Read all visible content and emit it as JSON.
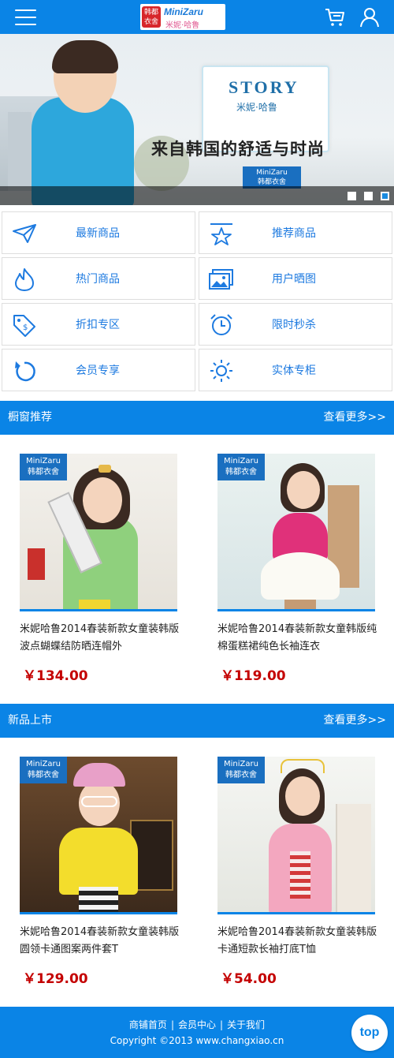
{
  "header": {
    "logo_badge": "韩都衣舍",
    "logo_brand": "MiniZaru",
    "logo_sub": "米妮·哈鲁"
  },
  "banner": {
    "story_title": "STORY",
    "story_sub": "米妮·哈鲁",
    "slogan": "来自韩国的舒适与时尚",
    "tag_en": "MiniZaru",
    "tag_cn": "韩都衣舍",
    "slide_count": 3,
    "active_slide": 3
  },
  "categories": [
    {
      "label": "最新商品",
      "icon": "paper-plane-icon"
    },
    {
      "label": "推荐商品",
      "icon": "star-icon"
    },
    {
      "label": "热门商品",
      "icon": "flame-icon"
    },
    {
      "label": "用户晒图",
      "icon": "image-icon"
    },
    {
      "label": "折扣专区",
      "icon": "price-tag-icon"
    },
    {
      "label": "限时秒杀",
      "icon": "alarm-clock-icon"
    },
    {
      "label": "会员专享",
      "icon": "refresh-icon"
    },
    {
      "label": "实体专柜",
      "icon": "sun-icon"
    }
  ],
  "sections": [
    {
      "title": "橱窗推荐",
      "more": "查看更多>>",
      "products": [
        {
          "name": "米妮哈鲁2014春装新款女童装韩版波点蝴蝶结防晒连帽外",
          "price": "￥134.00"
        },
        {
          "name": "米妮哈鲁2014春装新款女童韩版纯棉蛋糕裙纯色长袖连衣",
          "price": "￥119.00"
        }
      ]
    },
    {
      "title": "新品上市",
      "more": "查看更多>>",
      "products": [
        {
          "name": "米妮哈鲁2014春装新款女童装韩版圆领卡通图案两件套T",
          "price": "￥129.00"
        },
        {
          "name": "米妮哈鲁2014春装新款女童装韩版卡通短款长袖打底T恤",
          "price": "￥54.00"
        }
      ]
    }
  ],
  "product_tag": {
    "en": "MiniZaru",
    "cn": "韩都衣舍"
  },
  "footer": {
    "links": [
      "商铺首页",
      "会员中心",
      "关于我们"
    ],
    "separator": "|",
    "copyright": "Copyright ©2013 www.changxiao.cn"
  },
  "top_button": "top",
  "colors": {
    "primary": "#0a84e6",
    "price": "#c40000",
    "category_text": "#1d7ae0"
  }
}
